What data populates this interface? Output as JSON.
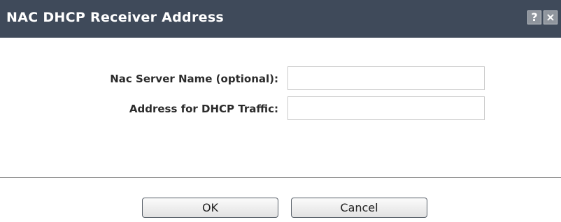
{
  "dialog": {
    "title": "NAC DHCP Receiver Address",
    "help_label": "?",
    "close_label": "×"
  },
  "form": {
    "server_name_label": "Nac Server Name (optional):",
    "server_name_value": "",
    "dhcp_address_label": "Address for DHCP Traffic:",
    "dhcp_address_value": ""
  },
  "buttons": {
    "ok_label": "OK",
    "cancel_label": "Cancel"
  },
  "colors": {
    "titlebar": "#3f4a5a",
    "title_text": "#ffffff",
    "divider": "#7a7a7a"
  }
}
